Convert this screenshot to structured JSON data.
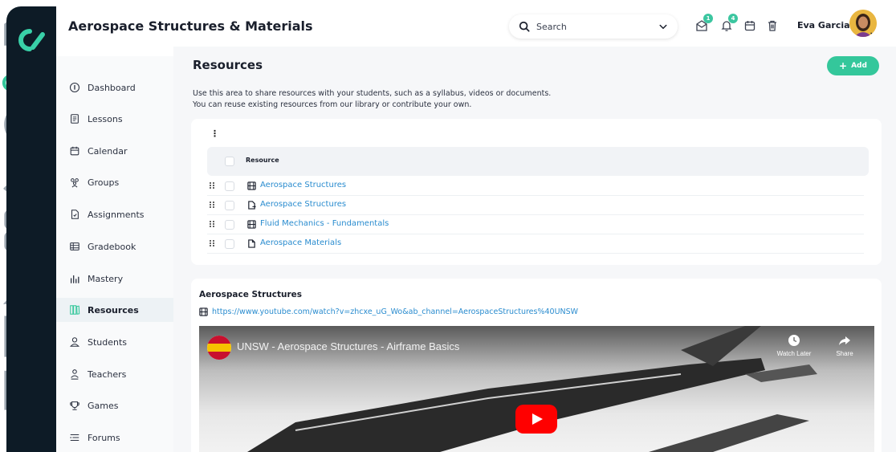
{
  "app": {
    "title": "Aerospace Structures & Materials",
    "logo": "CL"
  },
  "colors": {
    "rail": "#0d1b26",
    "accent": "#34c79b",
    "link": "#2a8ccf"
  },
  "search": {
    "placeholder": "Search"
  },
  "header_icons": [
    {
      "name": "messages-icon",
      "badge": "1"
    },
    {
      "name": "notifications-icon",
      "badge": "4"
    },
    {
      "name": "calendar-icon"
    },
    {
      "name": "trash-icon"
    }
  ],
  "user": {
    "name": "Eva Garcia"
  },
  "rail_icons": [
    "home-icon",
    "courses-icon",
    "target-icon",
    "users-icon",
    "apps-icon",
    "profile-icon",
    "library-icon",
    "analytics-icon"
  ],
  "menu": [
    {
      "label": "Dashboard",
      "icon": "dashboard-icon"
    },
    {
      "label": "Lessons",
      "icon": "lessons-icon"
    },
    {
      "label": "Calendar",
      "icon": "calendar-icon"
    },
    {
      "label": "Groups",
      "icon": "groups-icon"
    },
    {
      "label": "Assignments",
      "icon": "assignments-icon"
    },
    {
      "label": "Gradebook",
      "icon": "gradebook-icon"
    },
    {
      "label": "Mastery",
      "icon": "mastery-icon"
    },
    {
      "label": "Resources",
      "icon": "resources-icon",
      "active": true
    },
    {
      "label": "Students",
      "icon": "student-icon"
    },
    {
      "label": "Teachers",
      "icon": "teacher-icon"
    },
    {
      "label": "Games",
      "icon": "games-icon"
    },
    {
      "label": "Forums",
      "icon": "forums-icon"
    }
  ],
  "resources": {
    "title": "Resources",
    "add_label": "Add",
    "description": [
      "Use this area to share resources with your students, such as a syllabus, videos or documents.",
      "You can reuse existing resources from our library or contribute your own."
    ],
    "column_header": "Resource",
    "rows": [
      {
        "icon": "video-file-icon",
        "label": "Aerospace Structures"
      },
      {
        "icon": "link-file-icon",
        "label": "Aerospace Structures"
      },
      {
        "icon": "video-file-icon",
        "label": "Fluid Mechanics - Fundamentals"
      },
      {
        "icon": "document-icon",
        "label": "Aerospace Materials"
      }
    ]
  },
  "preview": {
    "title": "Aerospace Structures",
    "url": "https://www.youtube.com/watch?v=zhcxe_uG_Wo&ab_channel=AerospaceStructures%40UNSW",
    "video_title": "UNSW - Aerospace Structures - Airframe Basics",
    "watch_later": "Watch Later",
    "share": "Share"
  }
}
